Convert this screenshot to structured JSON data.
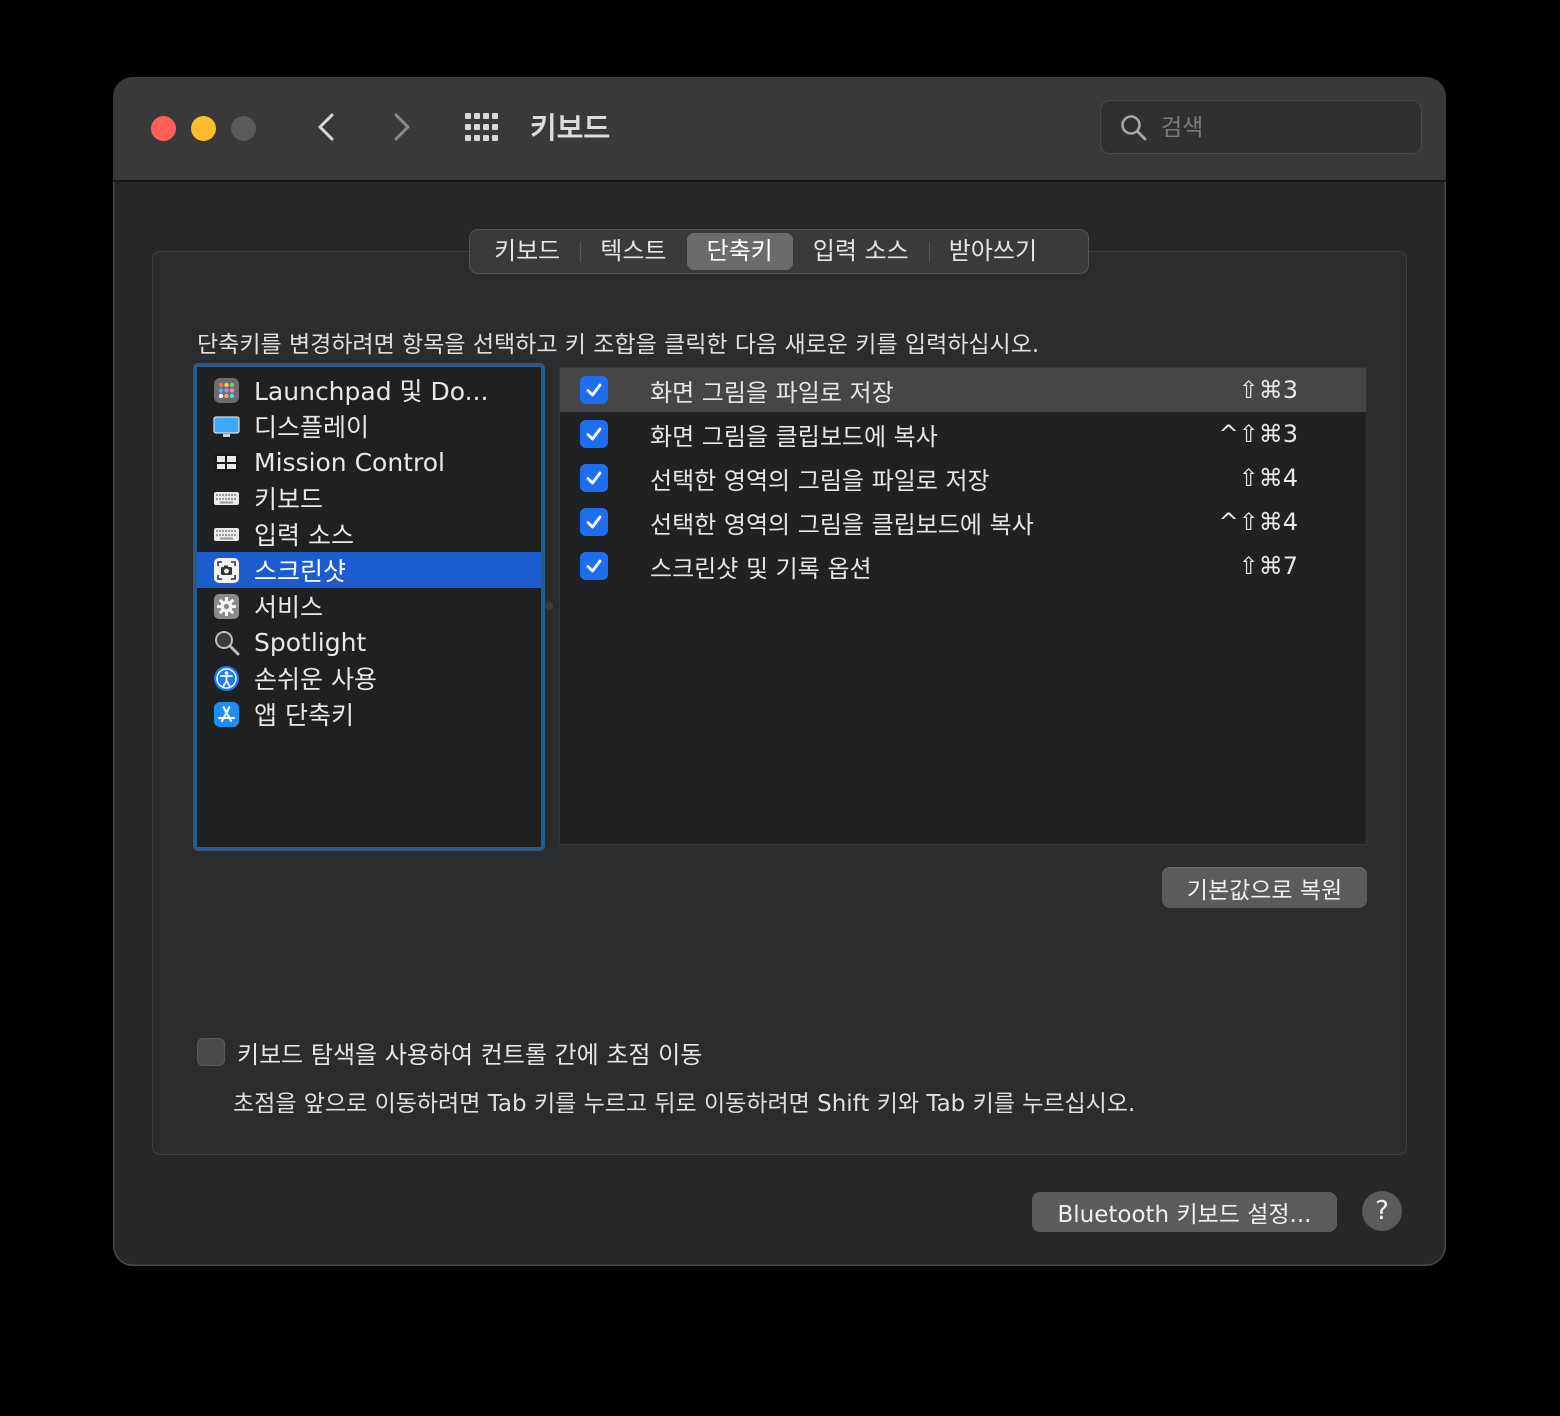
{
  "window": {
    "title": "키보드",
    "search_placeholder": "검색"
  },
  "tabs": [
    {
      "label": "키보드",
      "active": false
    },
    {
      "label": "텍스트",
      "active": false
    },
    {
      "label": "단축키",
      "active": true
    },
    {
      "label": "입력 소스",
      "active": false
    },
    {
      "label": "받아쓰기",
      "active": false
    }
  ],
  "instruction": "단축키를 변경하려면 항목을 선택하고 키 조합을 클릭한 다음 새로운 키를 입력하십시오.",
  "categories": [
    {
      "label": "Launchpad 및 Do...",
      "icon": "launchpad-icon"
    },
    {
      "label": "디스플레이",
      "icon": "display-icon"
    },
    {
      "label": "Mission Control",
      "icon": "mission-control-icon"
    },
    {
      "label": "키보드",
      "icon": "keyboard-icon"
    },
    {
      "label": "입력 소스",
      "icon": "keyboard-icon"
    },
    {
      "label": "스크린샷",
      "icon": "screenshot-icon",
      "selected": true
    },
    {
      "label": "서비스",
      "icon": "gear-icon"
    },
    {
      "label": "Spotlight",
      "icon": "magnifier-icon"
    },
    {
      "label": "손쉬운 사용",
      "icon": "accessibility-icon"
    },
    {
      "label": "앱 단축키",
      "icon": "app-store-icon"
    }
  ],
  "shortcuts": [
    {
      "label": "화면 그림을 파일로 저장",
      "key": "⇧⌘3",
      "checked": true
    },
    {
      "label": "화면 그림을 클립보드에 복사",
      "key": "^⇧⌘3",
      "checked": true
    },
    {
      "label": "선택한 영역의 그림을 파일로 저장",
      "key": "⇧⌘4",
      "checked": true
    },
    {
      "label": "선택한 영역의 그림을 클립보드에 복사",
      "key": "^⇧⌘4",
      "checked": true
    },
    {
      "label": "스크린샷 및 기록 옵션",
      "key": "⇧⌘7",
      "checked": true
    }
  ],
  "restore_button": "기본값으로 복원",
  "keyboard_nav": {
    "label": "키보드 탐색을 사용하여 컨트롤 간에 초점 이동",
    "checked": false,
    "description": "초점을 앞으로 이동하려면 Tab 키를 누르고 뒤로 이동하려면 Shift 키와 Tab 키를 누르십시오."
  },
  "bluetooth_button": "Bluetooth 키보드 설정...",
  "help_button": "?",
  "colors": {
    "accent": "#1b5ccf",
    "checkbox": "#1e6ff0",
    "focus_ring": "#265b8c"
  }
}
